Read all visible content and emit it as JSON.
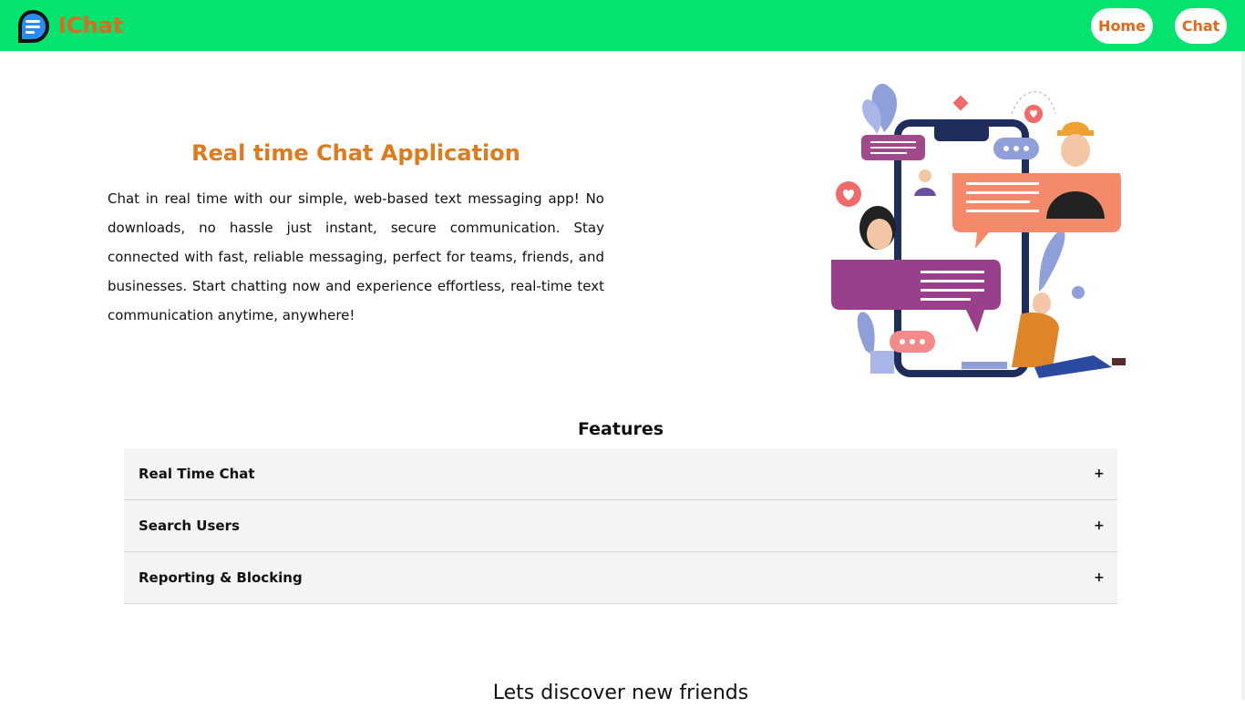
{
  "brand": {
    "name": "IChat",
    "logo_icon": "chat-bubble-lines-icon",
    "color": "#e06a1a"
  },
  "nav": {
    "background": "#03e36d",
    "items": [
      {
        "label": "Home"
      },
      {
        "label": "Chat"
      }
    ]
  },
  "hero": {
    "title": "Real time Chat Application",
    "text": "Chat in real time with our simple, web-based text messaging app! No downloads, no hassle just instant, secure communication. Stay connected with fast, reliable messaging, perfect for teams, friends, and businesses. Start chatting now and experience effortless, real-time text communication anytime, anywhere!",
    "illustration": "chat-app-illustration"
  },
  "features": {
    "title": "Features",
    "items": [
      {
        "label": "Real Time Chat",
        "icon": "+"
      },
      {
        "label": "Search Users",
        "icon": "+"
      },
      {
        "label": "Reporting & Blocking",
        "icon": "+"
      }
    ]
  },
  "discover": {
    "title": "Lets discover new friends"
  }
}
